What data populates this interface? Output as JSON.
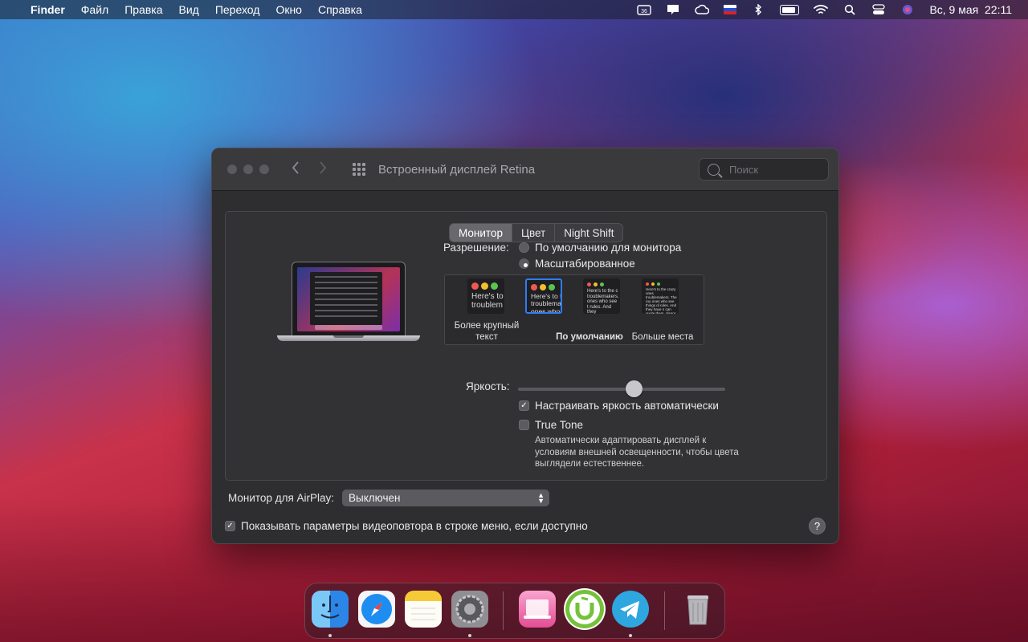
{
  "menubar": {
    "apple_glyph": "",
    "app_name": "Finder",
    "items": [
      "Файл",
      "Правка",
      "Вид",
      "Переход",
      "Окно",
      "Справка"
    ],
    "status_badge": "36",
    "clock": "Вс, 9 мая  22:11",
    "icons": [
      "app-badge-icon",
      "notification-icon",
      "creative-cloud-icon",
      "russian-flag-icon",
      "bluetooth-icon",
      "battery-icon",
      "wifi-icon",
      "search-icon",
      "control-center-icon",
      "siri-icon"
    ]
  },
  "window": {
    "title": "Встроенный дисплей Retina",
    "search_placeholder": "Поиск",
    "tabs": [
      {
        "label": "Монитор",
        "active": true
      },
      {
        "label": "Цвет",
        "active": false
      },
      {
        "label": "Night Shift",
        "active": false
      }
    ],
    "resolution": {
      "label": "Разрешение:",
      "options": [
        {
          "label": "По умолчанию для монитора",
          "selected": false
        },
        {
          "label": "Масштабированное",
          "selected": true
        }
      ],
      "scales": [
        {
          "preview": "Here's to troublem",
          "label": "Более крупный текст"
        },
        {
          "preview": "Here's to t troublema ones who",
          "label": "",
          "selected": true
        },
        {
          "preview": "Here's to the c troublemakers. ones who see t rules. And they",
          "label": "По умолчанию"
        },
        {
          "preview": "Here's to the crazy ones troublemakers. The rou ones who see things di rules. And they have n can quote them, disagr them. About the only thi Because they change th",
          "label": "Больше места"
        }
      ]
    },
    "brightness": {
      "label": "Яркость:",
      "level": 0.56,
      "auto_label": "Настраивать яркость автоматически",
      "auto_checked": true
    },
    "true_tone": {
      "label": "True Tone",
      "checked": false,
      "description": "Автоматически адаптировать дисплей к условиям внешней освещенности, чтобы цвета выглядели естественнее."
    },
    "airplay": {
      "label": "Монитор для AirPlay:",
      "value": "Выключен"
    },
    "mirroring": {
      "label": "Показывать параметры видеоповтора в строке меню, если доступно",
      "checked": true
    },
    "help_glyph": "?"
  },
  "dock": {
    "apps": [
      "Finder",
      "Safari",
      "Notes",
      "System Preferences",
      "CleanMyMac",
      "uTorrent",
      "Telegram",
      "Trash"
    ]
  }
}
